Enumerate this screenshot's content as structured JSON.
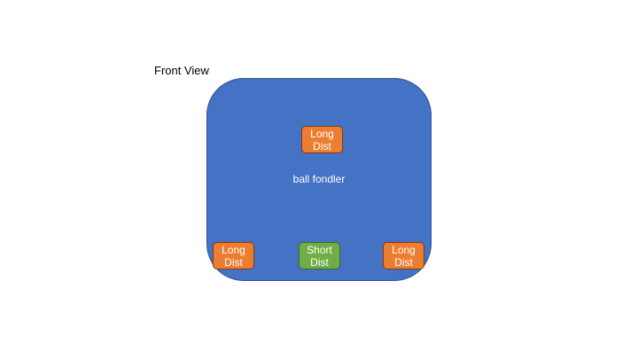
{
  "view_label": "Front View",
  "device": {
    "label": "ball fondler",
    "color": "#4472c4"
  },
  "sensors": [
    {
      "label": "Long\nDist",
      "kind": "long",
      "color": "#ed7d31"
    },
    {
      "label": "Long\nDist",
      "kind": "long",
      "color": "#ed7d31"
    },
    {
      "label": "Short\nDist",
      "kind": "short",
      "color": "#70ad47"
    },
    {
      "label": "Long\nDist",
      "kind": "long",
      "color": "#ed7d31"
    }
  ]
}
